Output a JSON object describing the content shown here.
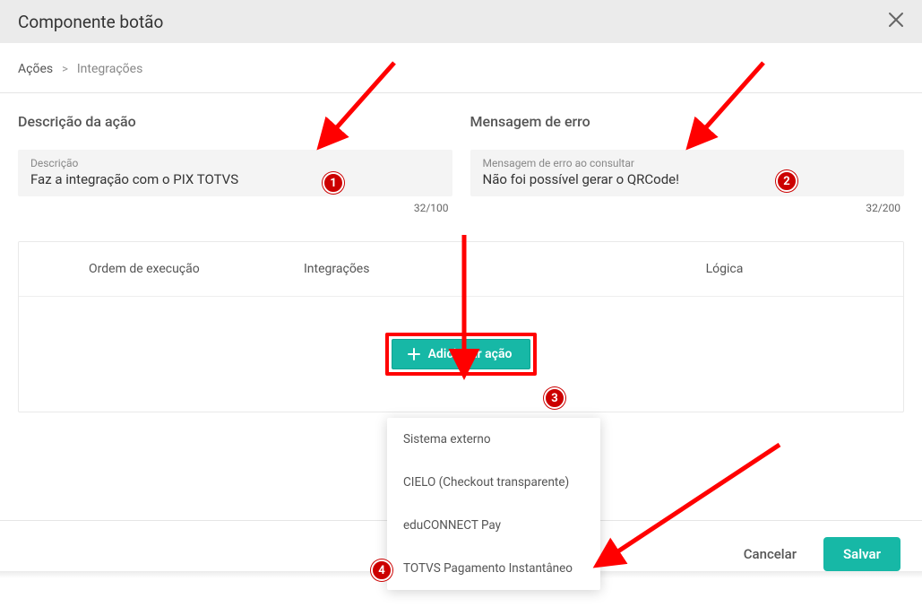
{
  "dialog": {
    "title": "Componente botão"
  },
  "breadcrumb": {
    "item1": "Ações",
    "item2": "Integrações"
  },
  "left": {
    "section_title": "Descrição da ação",
    "label": "Descrição",
    "value": "Faz a integração com o PIX TOTVS",
    "counter": "32/100"
  },
  "right": {
    "section_title": "Mensagem de erro",
    "label": "Mensagem de erro ao consultar",
    "value": "Não foi possível gerar o QRCode!",
    "counter": "32/200"
  },
  "table": {
    "th_ordem": "Ordem de execução",
    "th_integ": "Integrações",
    "th_logica": "Lógica"
  },
  "add_button": {
    "label": "Adicionar ação"
  },
  "dropdown": {
    "opt1": "Sistema externo",
    "opt2": "CIELO (Checkout transparente)",
    "opt3": "eduCONNECT Pay",
    "opt4": "TOTVS Pagamento Instantâneo"
  },
  "footer": {
    "cancel": "Cancelar",
    "save": "Salvar"
  },
  "annotations": {
    "b1": "1",
    "b2": "2",
    "b3": "3",
    "b4": "4"
  }
}
